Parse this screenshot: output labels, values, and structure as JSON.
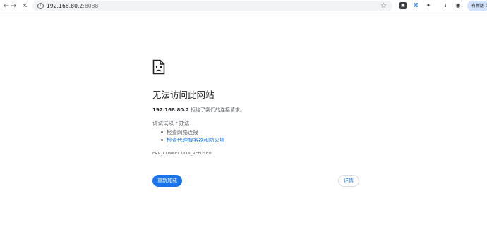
{
  "browser": {
    "back_icon": "arrow-left-icon",
    "forward_icon": "arrow-right-icon",
    "stop_icon": "close-icon",
    "url_host": "192.168.80.2",
    "url_port": ":8088",
    "profile_label": "有新版 C"
  },
  "error_page": {
    "title": "无法访问此网站",
    "summary_host": "192.168.80.2",
    "summary_text": " 拒绝了我们的连接请求。",
    "suggestions_heading": "请试试以下办法：",
    "suggestions": [
      {
        "label": "检查网络连接"
      },
      {
        "label": "检查代理服务器和防火墙"
      }
    ],
    "error_code": "ERR_CONNECTION_REFUSED",
    "reload_label": "重新加载",
    "details_label": "详情"
  },
  "colors": {
    "accent": "#1a73e8",
    "text_secondary": "#5f6368",
    "omnibox_bg": "#f1f3f4"
  }
}
